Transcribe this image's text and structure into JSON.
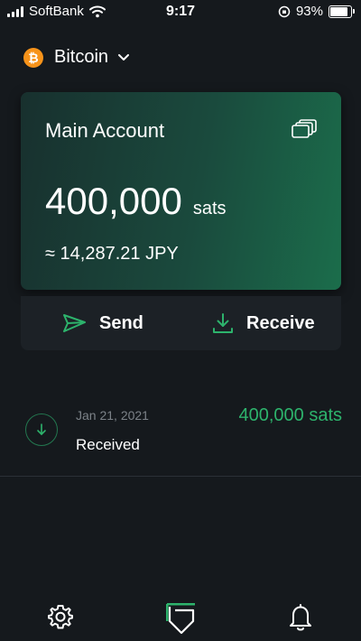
{
  "status_bar": {
    "carrier": "SoftBank",
    "time": "9:17",
    "battery": "93%",
    "battery_level": 0.93
  },
  "coin": {
    "name": "Bitcoin",
    "symbol": "₿",
    "icon": "bitcoin-icon",
    "color": "#f7931a"
  },
  "account": {
    "name": "Main Account",
    "balance": "400,000",
    "unit": "sats",
    "fiat": "≈ 14,287.21 JPY"
  },
  "actions": {
    "send": "Send",
    "receive": "Receive"
  },
  "transactions": [
    {
      "date": "Jan 21, 2021",
      "type": "Received",
      "amount": "400,000 sats",
      "icon": "download-icon"
    }
  ],
  "tabs": [
    {
      "icon": "gear-icon"
    },
    {
      "icon": "shield-icon",
      "active": true
    },
    {
      "icon": "bell-icon"
    }
  ],
  "colors": {
    "accent": "#2db36c",
    "background": "#15191d"
  }
}
